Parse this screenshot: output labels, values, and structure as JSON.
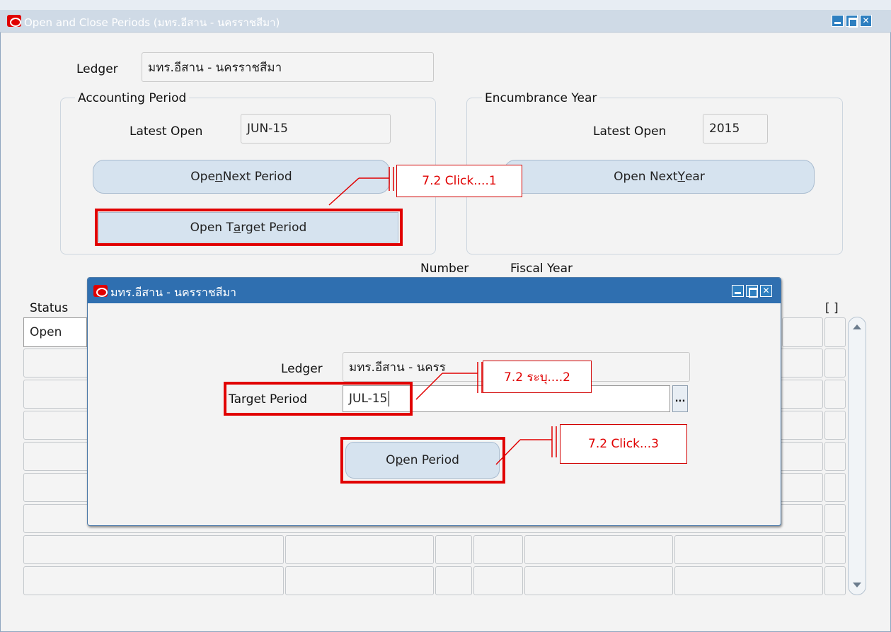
{
  "main_window": {
    "title": "Open and Close Periods (มทร.อีสาน - นครราชสีมา)",
    "ledger_label": "Ledger",
    "ledger_value": "มทร.อีสาน - นครราชสีมา"
  },
  "accounting_period": {
    "legend": "Accounting Period",
    "latest_open_label": "Latest Open",
    "latest_open_value": "JUN-15",
    "open_next_period_pre": "Ope",
    "open_next_period_key": "n",
    "open_next_period_post": " Next Period",
    "open_target_period_pre": "Open T",
    "open_target_period_key": "a",
    "open_target_period_post": "rget Period"
  },
  "encumbrance_year": {
    "legend": "Encumbrance Year",
    "latest_open_label": "Latest Open",
    "latest_open_value": "2015",
    "open_next_year_pre": "Open Next ",
    "open_next_year_key": "Y",
    "open_next_year_post": "ear"
  },
  "table": {
    "headers": {
      "number": "Number",
      "fiscal_year": "Fiscal Year",
      "status": "Status",
      "bracket": "[ ]"
    },
    "first_status": "Open"
  },
  "dialog": {
    "title": "มทร.อีสาน - นครราชสีมา",
    "ledger_label": "Ledger",
    "ledger_value": "มทร.อีสาน - นครร",
    "target_period_label": "Target Period",
    "target_period_value": "JUL-15",
    "lov_button": "...",
    "open_period_pre": "O",
    "open_period_key": "p",
    "open_period_post": "en Period"
  },
  "callouts": {
    "step1": "7.2 Click....1",
    "step2": "7.2 ระบุ....2",
    "step3": "7.2 Click...3"
  },
  "colors": {
    "annotation_red": "#e10000",
    "title_bar_blue": "#2f6fb0",
    "button_fill": "#d6e3ef"
  }
}
